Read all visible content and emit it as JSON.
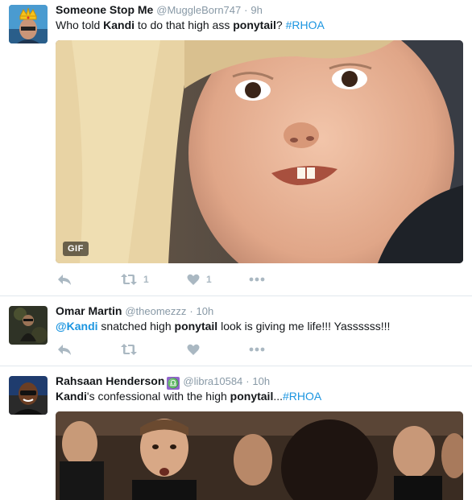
{
  "tweets": [
    {
      "name": "Someone Stop Me",
      "handle": "@MuggleBorn747",
      "sep": "·",
      "time": "9h",
      "text_parts": [
        "Who told ",
        "Kandi",
        " to do that high ass ",
        "ponytail",
        "? ",
        "#RHOA"
      ],
      "media_badge": "GIF",
      "retweets": "1",
      "likes": "1"
    },
    {
      "name": "Omar Martin",
      "handle": "@theomezzz",
      "sep": "·",
      "time": "10h",
      "text_parts": [
        "@Kandi",
        " snatched high ",
        "ponytail",
        " look is giving me life!!! Yassssss!!!"
      ]
    },
    {
      "name": "Rahsaan Henderson",
      "badge_glyph": "♎",
      "handle": "@libra10584",
      "sep": "·",
      "time": "10h",
      "text_parts": [
        "Kandi",
        "'s confessional with the high ",
        "ponytail",
        "...",
        "#RHOA"
      ]
    }
  ],
  "colors": {
    "link": "#1b95e0",
    "muted": "#8899a6",
    "action": "#aab8c2",
    "divider": "#e1e8ed"
  },
  "icons": [
    "reply-icon",
    "retweet-icon",
    "heart-icon",
    "more-icon",
    "crown-icon",
    "libra-icon"
  ]
}
